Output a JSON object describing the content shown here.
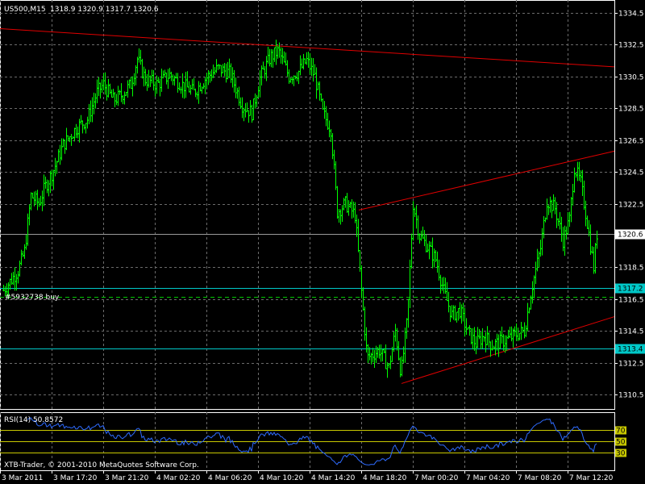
{
  "window": {
    "symbol_label": "US500,M15",
    "ohlc_label": "1318.9 1320.9 1317.7 1320.6",
    "order_label": "#5932738 buy",
    "copyright": "XTB-Trader, © 2001-2010 MetaQuotes Software Corp."
  },
  "price_axis": {
    "ticks": [
      {
        "label": "1334.5",
        "value": 1334.5
      },
      {
        "label": "1332.5",
        "value": 1332.5
      },
      {
        "label": "1330.5",
        "value": 1330.5
      },
      {
        "label": "1328.5",
        "value": 1328.5
      },
      {
        "label": "1326.5",
        "value": 1326.5
      },
      {
        "label": "1324.5",
        "value": 1324.5
      },
      {
        "label": "1322.5",
        "value": 1322.5
      },
      {
        "label": "1318.5",
        "value": 1318.5
      },
      {
        "label": "1316.5",
        "value": 1316.5
      },
      {
        "label": "1314.5",
        "value": 1314.5
      },
      {
        "label": "1312.5",
        "value": 1312.5
      },
      {
        "label": "1310.5",
        "value": 1310.5
      }
    ],
    "range": [
      1309.6,
      1335.3
    ],
    "current_price": {
      "label": "1320.6",
      "value": 1320.6
    },
    "levels": [
      {
        "label": "1317.2",
        "value": 1317.2,
        "color": "#00c8c8"
      },
      {
        "label": "1313.4",
        "value": 1313.4,
        "color": "#00c8c8"
      }
    ],
    "order_level": 1316.65
  },
  "time_axis": {
    "labels": [
      "3 Mar 2011",
      "3 Mar 17:20",
      "3 Mar 21:20",
      "4 Mar 02:20",
      "4 Mar 06:20",
      "4 Mar 10:20",
      "4 Mar 14:20",
      "4 Mar 18:20",
      "7 Mar 00:20",
      "7 Mar 04:20",
      "7 Mar 08:20",
      "7 Mar 12:20"
    ]
  },
  "rsi": {
    "label": "RSI(14) 50.8572",
    "levels": [
      {
        "label": "70",
        "value": 70
      },
      {
        "label": "50",
        "value": 50
      },
      {
        "label": "30",
        "value": 30
      }
    ],
    "color": "#2e6bff"
  },
  "chart_data": {
    "type": "line",
    "series": [],
    "xlabel": "",
    "ylabel": "",
    "ylim": [
      1309.6,
      1335.3
    ],
    "grid": true,
    "bar_color": "#00ff00",
    "trendline_color": "#e00000",
    "guide_points": [
      [
        0,
        1316.8
      ],
      [
        12,
        1317.6
      ],
      [
        22,
        1318.3
      ],
      [
        30,
        1319.5
      ],
      [
        38,
        1323
      ],
      [
        48,
        1322.5
      ],
      [
        55,
        1323.5
      ],
      [
        65,
        1324.5
      ],
      [
        78,
        1326.2
      ],
      [
        95,
        1327.3
      ],
      [
        108,
        1327.8
      ],
      [
        120,
        1329.5
      ],
      [
        128,
        1330
      ],
      [
        140,
        1329
      ],
      [
        150,
        1329.3
      ],
      [
        162,
        1330
      ],
      [
        170,
        1331.6
      ],
      [
        180,
        1330.3
      ],
      [
        195,
        1330
      ],
      [
        210,
        1330.6
      ],
      [
        225,
        1330
      ],
      [
        240,
        1329.5
      ],
      [
        255,
        1330.4
      ],
      [
        270,
        1331
      ],
      [
        285,
        1330.7
      ],
      [
        300,
        1328.7
      ],
      [
        312,
        1328.2
      ],
      [
        322,
        1330.4
      ],
      [
        335,
        1331.7
      ],
      [
        345,
        1332.1
      ],
      [
        358,
        1330.5
      ],
      [
        370,
        1330.8
      ],
      [
        380,
        1331.5
      ],
      [
        390,
        1330.5
      ],
      [
        400,
        1328.2
      ],
      [
        410,
        1327.2
      ],
      [
        418,
        1322
      ],
      [
        428,
        1322.5
      ],
      [
        440,
        1321.8
      ],
      [
        448,
        1317
      ],
      [
        455,
        1312.8
      ],
      [
        470,
        1313.3
      ],
      [
        482,
        1312.2
      ],
      [
        490,
        1314.5
      ],
      [
        497,
        1311.8
      ],
      [
        505,
        1315.3
      ],
      [
        512,
        1322.5
      ],
      [
        520,
        1320.5
      ],
      [
        530,
        1319.8
      ],
      [
        540,
        1319
      ],
      [
        550,
        1317
      ],
      [
        560,
        1315.5
      ],
      [
        570,
        1315.8
      ],
      [
        580,
        1314.4
      ],
      [
        590,
        1313.7
      ],
      [
        600,
        1314.2
      ],
      [
        610,
        1313.6
      ],
      [
        620,
        1313.8
      ],
      [
        630,
        1314
      ],
      [
        640,
        1314.3
      ],
      [
        650,
        1314.5
      ],
      [
        660,
        1317.4
      ],
      [
        670,
        1319.7
      ],
      [
        678,
        1322.7
      ],
      [
        688,
        1322.2
      ],
      [
        698,
        1320.2
      ],
      [
        706,
        1321.5
      ],
      [
        712,
        1324.8
      ],
      [
        720,
        1323.8
      ],
      [
        728,
        1321.3
      ],
      [
        736,
        1318.5
      ],
      [
        740,
        1320.6
      ]
    ],
    "trendlines": [
      {
        "p1": {
          "x": 0,
          "y": 1333.5
        },
        "p2": {
          "x": 762,
          "y": 1331.1
        }
      },
      {
        "p1": {
          "x": 445,
          "y": 1322.1
        },
        "p2": {
          "x": 762,
          "y": 1325.8
        }
      },
      {
        "p1": {
          "x": 498,
          "y": 1311.2
        },
        "p2": {
          "x": 762,
          "y": 1315.4
        }
      }
    ]
  }
}
